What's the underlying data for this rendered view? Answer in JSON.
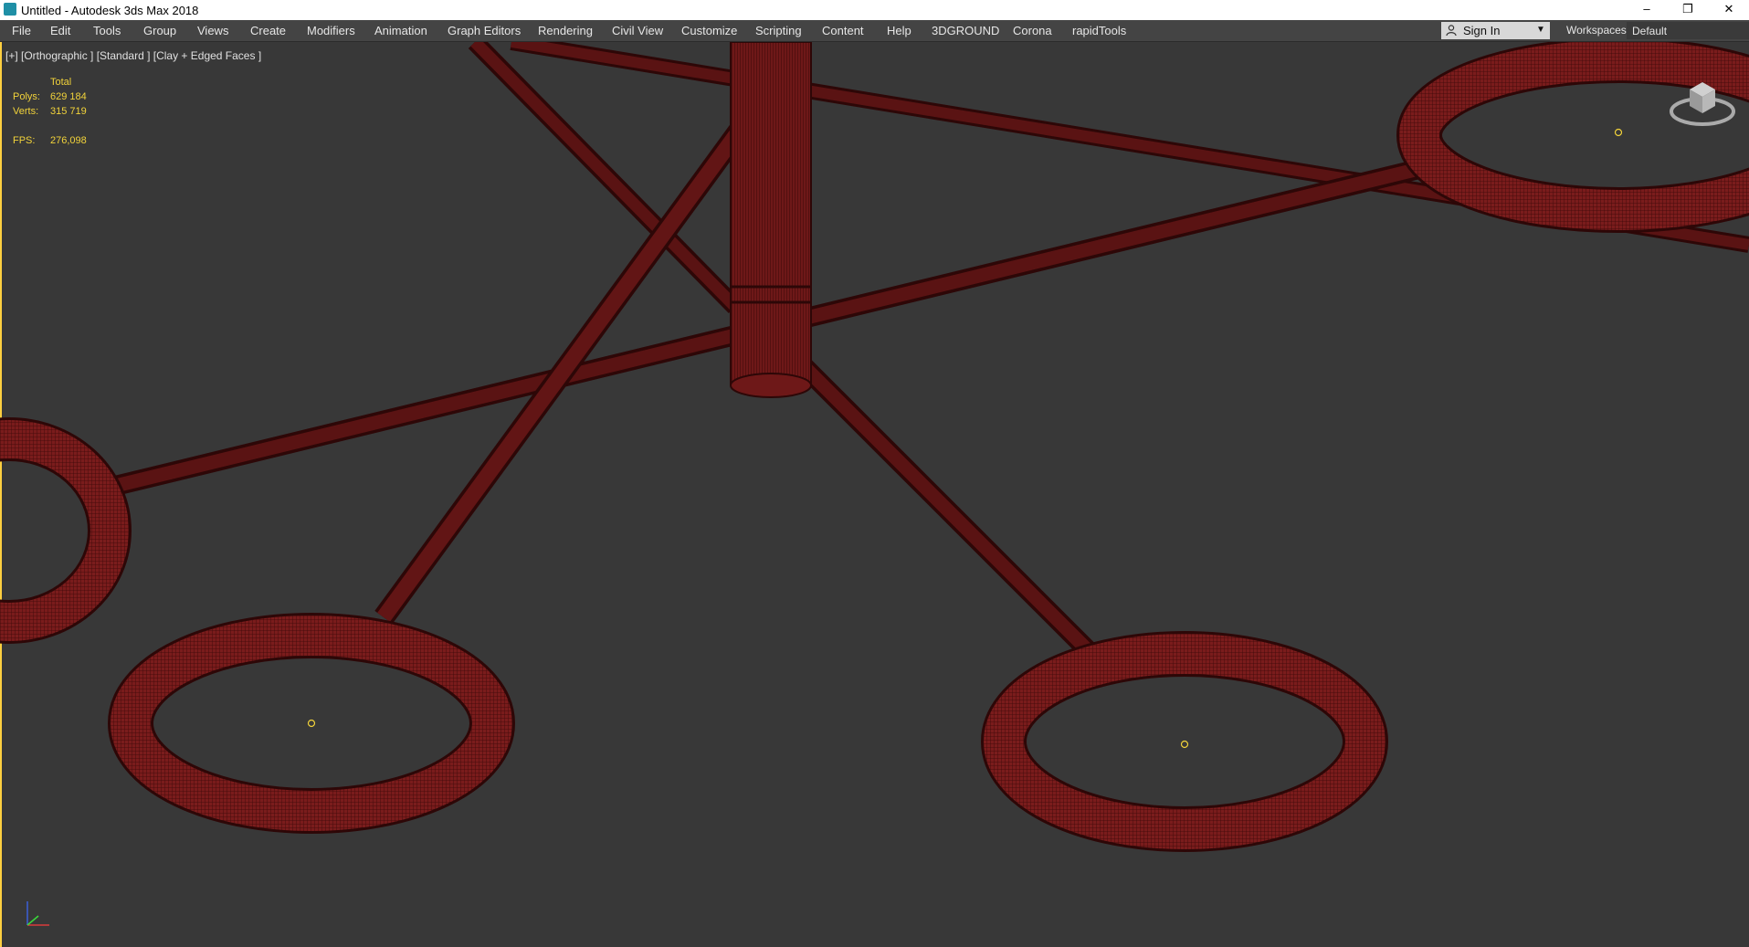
{
  "window": {
    "title": "Untitled - Autodesk 3ds Max 2018",
    "controls": {
      "minimize": "–",
      "restore": "❐",
      "close": "✕"
    }
  },
  "menu": {
    "items": [
      "File",
      "Edit",
      "Tools",
      "Group",
      "Views",
      "Create",
      "Modifiers",
      "Animation",
      "Graph Editors",
      "Rendering",
      "Civil View",
      "Customize",
      "Scripting",
      "Content",
      "Help",
      "3DGROUND",
      "Corona",
      "rapidTools"
    ],
    "sign_in": "Sign In",
    "workspaces_label": "Workspaces:",
    "workspace_value": "Default"
  },
  "viewport": {
    "label": "[+] [Orthographic ] [Standard ] [Clay + Edged Faces ]",
    "stats": {
      "total_label": "Total",
      "polys_label": "Polys:",
      "polys_value": "629 184",
      "verts_label": "Verts:",
      "verts_value": "315 719",
      "fps_label": "FPS:",
      "fps_value": "276,098"
    },
    "viewcube_icon": "viewcube-icon",
    "axis_icon": "axis-tripod-icon",
    "colors": {
      "mesh": "#7a1c1c",
      "wire": "#3a0808",
      "pivot": "#f2d33a",
      "accent": "#ffcf40"
    }
  }
}
